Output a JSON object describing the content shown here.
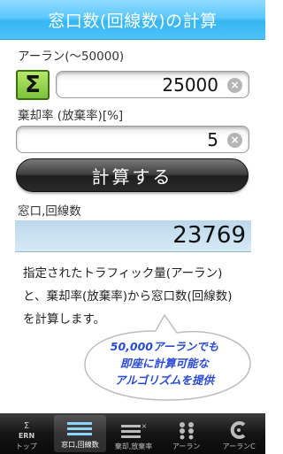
{
  "header": {
    "title": "窓口数(回線数)の計算"
  },
  "erlang_input": {
    "label": "アーラン(〜50000)",
    "value": "25000",
    "sigma": "Σ",
    "clear": "×"
  },
  "loss_input": {
    "label": "棄却率 (放棄率)[%]",
    "value": "5",
    "clear": "×"
  },
  "calculate": {
    "label": "計算する"
  },
  "result": {
    "label": "窓口,回線数",
    "value": "23769"
  },
  "description": "指定されたトラフィック量(アーラン)と、棄却率(放棄率)から窓口数(回線数)を計算します。",
  "bubble": {
    "line1": "50,000アーランでも",
    "line2": "即座に計算可能な",
    "line3": "アルゴリズムを提供"
  },
  "tabs": [
    {
      "label": "トップ",
      "icon": "erlang-sigma-icon",
      "active": false
    },
    {
      "label": "窓口,回線数",
      "icon": "lines-icon",
      "active": true
    },
    {
      "label": "棄却,放棄率",
      "icon": "loss-rate-icon",
      "active": false
    },
    {
      "label": "アーラン",
      "icon": "dots-grid-icon",
      "active": false
    },
    {
      "label": "アーランC",
      "icon": "erlang-c-icon",
      "active": false
    }
  ],
  "colors": {
    "header": "#4ec3fa",
    "sigma_button": "#8ed04a",
    "result_bg": "#c9e1f2",
    "bubble_text": "#2a4bd6"
  }
}
